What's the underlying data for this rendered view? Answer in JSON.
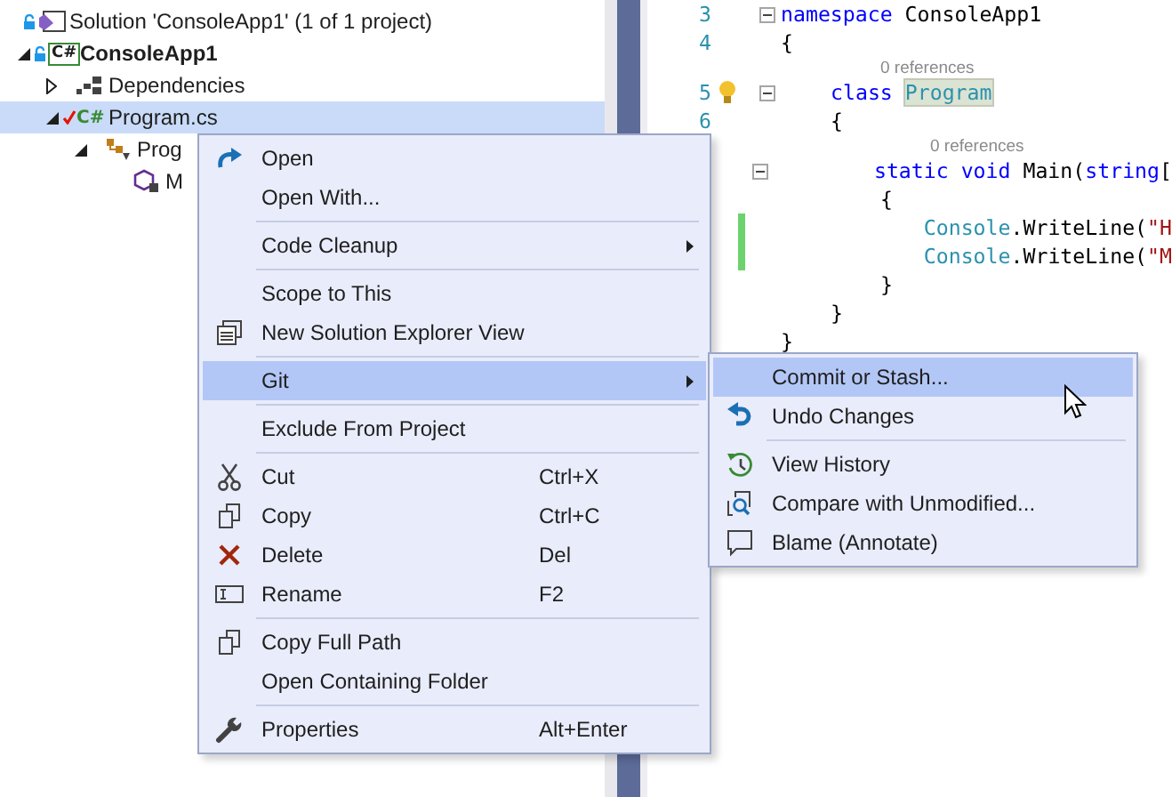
{
  "solution_explorer": {
    "items": [
      {
        "label": "Solution 'ConsoleApp1' (1 of 1 project)",
        "kind": "solution",
        "locked": true,
        "pending_edit": false,
        "selected": false,
        "bold": false,
        "children": [
          {
            "label": "ConsoleApp1",
            "kind": "project",
            "badge": "C#",
            "locked": true,
            "pending_edit": false,
            "expanded": true,
            "selected": false,
            "bold": true,
            "children": [
              {
                "label": "Dependencies",
                "kind": "dependencies",
                "locked": false,
                "pending_edit": false,
                "expanded": false,
                "selected": false,
                "bold": false
              },
              {
                "label": "Program.cs",
                "kind": "csfile",
                "badge": "C#",
                "locked": false,
                "pending_edit": true,
                "expanded": true,
                "selected": true,
                "bold": false,
                "children": [
                  {
                    "label": "Prog",
                    "kind": "class",
                    "locked": false,
                    "pending_edit": false,
                    "expanded": true,
                    "selected": false,
                    "bold": false,
                    "children": [
                      {
                        "label": "M",
                        "kind": "method",
                        "locked": false,
                        "pending_edit": false,
                        "selected": false,
                        "bold": false
                      }
                    ]
                  }
                ]
              }
            ]
          }
        ]
      }
    ]
  },
  "editor": {
    "lines": [
      {
        "kind": "code",
        "number": "3",
        "fold": true,
        "tokens": [
          {
            "text": "namespace",
            "kind": "keyword"
          },
          {
            "text": " ConsoleApp1",
            "kind": "plain"
          }
        ]
      },
      {
        "kind": "code",
        "number": "4",
        "tokens": [
          {
            "text": "{",
            "kind": "plain"
          }
        ]
      },
      {
        "kind": "block",
        "children": [
          {
            "kind": "codelens",
            "text": "0 references"
          },
          {
            "kind": "code",
            "number": "5",
            "fold": true,
            "lightbulb": true,
            "tokens": [
              {
                "text": "class",
                "kind": "keyword",
                "highlighted": false
              },
              {
                "text": "Program",
                "kind": "type",
                "space_before": true,
                "highlighted": true
              }
            ]
          },
          {
            "kind": "code",
            "number": "6",
            "tokens": [
              {
                "text": "{",
                "kind": "plain"
              }
            ]
          },
          {
            "kind": "block",
            "children": [
              {
                "kind": "codelens",
                "text": "0 references"
              },
              {
                "kind": "code",
                "fold": true,
                "tokens": [
                  {
                    "text": "static",
                    "kind": "keyword"
                  },
                  {
                    "text": "void",
                    "kind": "keyword",
                    "space_before": true
                  },
                  {
                    "text": "Main(",
                    "kind": "plain",
                    "space_before": true
                  },
                  {
                    "text": "string",
                    "kind": "keyword"
                  },
                  {
                    "text": "[",
                    "kind": "plain"
                  }
                ]
              },
              {
                "kind": "code",
                "tokens": [
                  {
                    "text": "{",
                    "kind": "plain"
                  }
                ]
              },
              {
                "kind": "block",
                "children": [
                  {
                    "kind": "code",
                    "changed": true,
                    "tokens": [
                      {
                        "text": "Console",
                        "kind": "type"
                      },
                      {
                        "text": ".WriteLine(",
                        "kind": "plain"
                      },
                      {
                        "text": "\"H",
                        "kind": "string"
                      }
                    ]
                  },
                  {
                    "kind": "code",
                    "changed": true,
                    "tokens": [
                      {
                        "text": "Console",
                        "kind": "type"
                      },
                      {
                        "text": ".WriteLine(",
                        "kind": "plain"
                      },
                      {
                        "text": "\"M",
                        "kind": "string"
                      }
                    ]
                  }
                ]
              },
              {
                "kind": "code",
                "tokens": [
                  {
                    "text": "}",
                    "kind": "plain"
                  }
                ]
              }
            ]
          },
          {
            "kind": "code",
            "tokens": [
              {
                "text": "}",
                "kind": "plain"
              }
            ]
          }
        ]
      },
      {
        "kind": "code",
        "tokens": [
          {
            "text": "}",
            "kind": "plain"
          }
        ]
      }
    ]
  },
  "context_menu": {
    "items": [
      {
        "kind": "item",
        "label": "Open",
        "selected": false
      },
      {
        "kind": "item",
        "label": "Open With...",
        "selected": false
      },
      {
        "kind": "separator"
      },
      {
        "kind": "item",
        "label": "Code Cleanup",
        "submenu": true,
        "selected": false
      },
      {
        "kind": "separator"
      },
      {
        "kind": "item",
        "label": "Scope to This",
        "selected": false
      },
      {
        "kind": "item",
        "label": "New Solution Explorer View",
        "selected": false
      },
      {
        "kind": "separator"
      },
      {
        "kind": "item",
        "label": "Git",
        "submenu": true,
        "selected": true
      },
      {
        "kind": "separator"
      },
      {
        "kind": "item",
        "label": "Exclude From Project",
        "selected": false
      },
      {
        "kind": "separator"
      },
      {
        "kind": "item",
        "label": "Cut",
        "shortcut": "Ctrl+X",
        "selected": false
      },
      {
        "kind": "item",
        "label": "Copy",
        "shortcut": "Ctrl+C",
        "selected": false
      },
      {
        "kind": "item",
        "label": "Delete",
        "shortcut": "Del",
        "selected": false
      },
      {
        "kind": "item",
        "label": "Rename",
        "shortcut": "F2",
        "selected": false
      },
      {
        "kind": "separator"
      },
      {
        "kind": "item",
        "label": "Copy Full Path",
        "selected": false
      },
      {
        "kind": "item",
        "label": "Open Containing Folder",
        "selected": false
      },
      {
        "kind": "separator"
      },
      {
        "kind": "item",
        "label": "Properties",
        "shortcut": "Alt+Enter",
        "selected": false
      }
    ]
  },
  "git_submenu": {
    "items": [
      {
        "kind": "item",
        "label": "Commit or Stash...",
        "selected": true
      },
      {
        "kind": "item",
        "label": "Undo Changes",
        "selected": false
      },
      {
        "kind": "separator"
      },
      {
        "kind": "item",
        "label": "View History",
        "selected": false
      },
      {
        "kind": "item",
        "label": "Compare with Unmodified...",
        "selected": false
      },
      {
        "kind": "item",
        "label": "Blame (Annotate)",
        "selected": false
      }
    ]
  }
}
